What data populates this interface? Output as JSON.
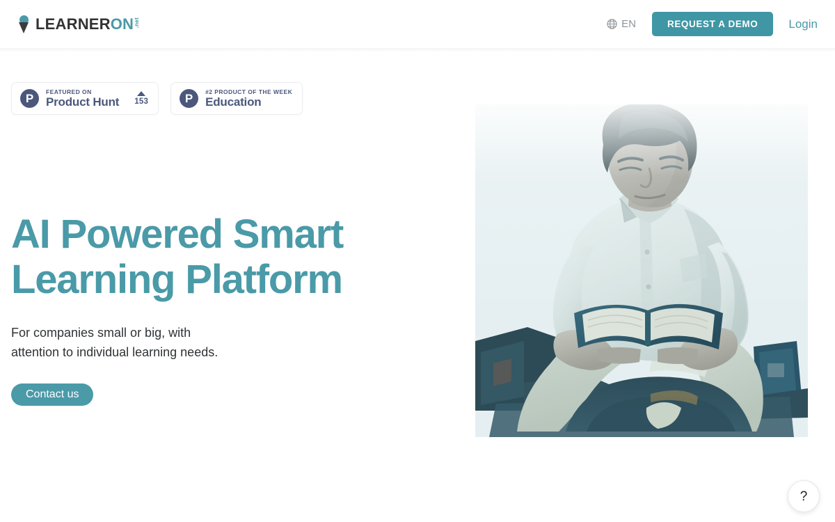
{
  "header": {
    "logo": {
      "icon": "location-pin-icon",
      "part_dark": "LEARNER",
      "part_accent": "ON",
      "suffix": ".net"
    },
    "lang": {
      "icon": "globe-icon",
      "label": "EN"
    },
    "demo_button": "REQUEST A DEMO",
    "login_link": "Login"
  },
  "badges": [
    {
      "logo_letter": "P",
      "kicker": "FEATURED ON",
      "title": "Product Hunt",
      "votes": "153",
      "has_votes": true
    },
    {
      "logo_letter": "P",
      "kicker": "#2 PRODUCT OF THE WEEK",
      "title": "Education",
      "votes": "",
      "has_votes": false
    }
  ],
  "hero": {
    "title": "AI Powered Smart\nLearning Platform",
    "subtitle": "For companies small or big, with\nattention to individual learning needs.",
    "cta": "Contact us",
    "illustration": "man-reading-book-illustration"
  },
  "help": {
    "icon": "question-mark-icon",
    "label": "?"
  },
  "colors": {
    "accent_teal": "#4a9aa8",
    "button_teal": "#3f96a4",
    "product_hunt_slate": "#4b587c",
    "text_dark": "#2f3336",
    "muted_gray": "#8d9398",
    "background": "#ffffff"
  }
}
